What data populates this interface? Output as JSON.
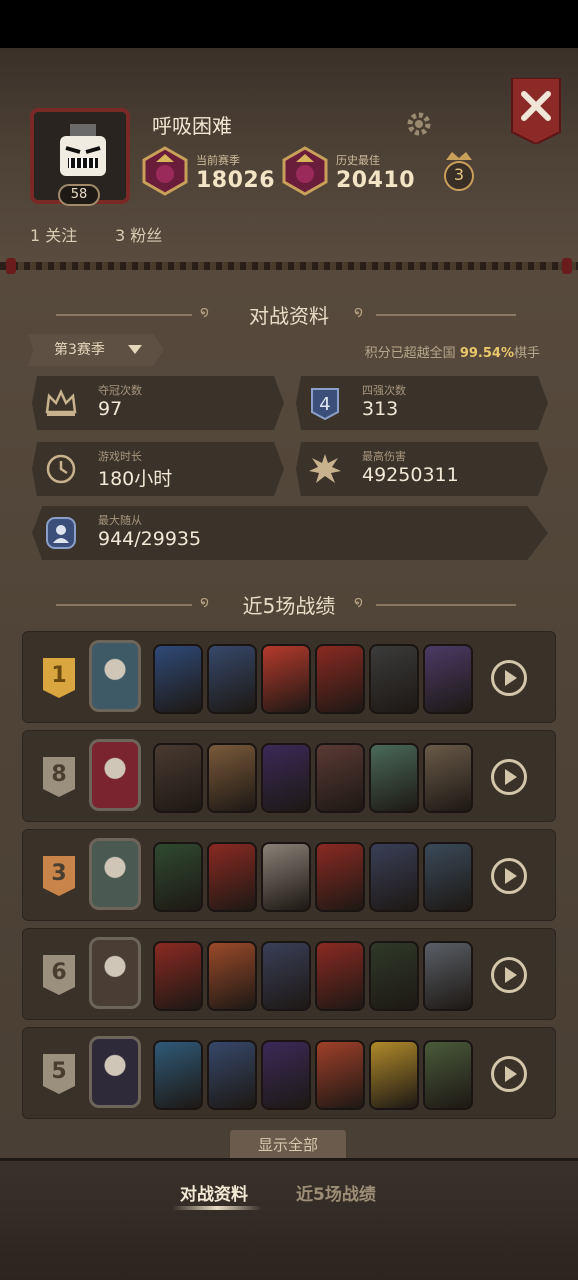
{
  "profile": {
    "name": "呼吸困难",
    "level": "58",
    "current_season_label": "当前赛季",
    "current_season_value": "18026",
    "best_label": "历史最佳",
    "best_value": "20410",
    "crown_count": "3",
    "following": "1 关注",
    "followers": "3 粉丝"
  },
  "battle_section": {
    "title": "对战资料",
    "season_select": "第3赛季",
    "beat_prefix": "积分已超越全国",
    "beat_percent": "99.54%",
    "beat_suffix": "棋手"
  },
  "stats": [
    {
      "label": "夺冠次数",
      "value": "97",
      "icon": "crown-icon"
    },
    {
      "label": "四强次数",
      "value": "313",
      "icon": "four-badge-icon"
    },
    {
      "label": "游戏时长",
      "value": "180小时",
      "icon": "clock-icon"
    },
    {
      "label": "最高伤害",
      "value": "49250311",
      "icon": "explosion-icon"
    },
    {
      "label": "最大随从",
      "value": "944/29935",
      "icon": "portrait-icon"
    }
  ],
  "recent_section": {
    "title": "近5场战绩",
    "matches": [
      {
        "place": "1",
        "badge_color": "#d9a640",
        "hero_color": "#3d5a66",
        "units": [
          "#2f4a78",
          "#36486a",
          "#b53a2c",
          "#8a2a22",
          "#3b3b3b",
          "#4b3b66"
        ]
      },
      {
        "place": "8",
        "badge_color": "#9b8f7e",
        "hero_color": "#7a2430",
        "units": [
          "#4a3a30",
          "#7a5a3a",
          "#3a2a58",
          "#5a3a34",
          "#4a6a5a",
          "#6a5a48"
        ]
      },
      {
        "place": "3",
        "badge_color": "#c9844a",
        "hero_color": "#4a5a52",
        "units": [
          "#2f4a30",
          "#8a2a22",
          "#8a8076",
          "#8a2a22",
          "#3a3f58",
          "#3a4a5a"
        ]
      },
      {
        "place": "6",
        "badge_color": "#9b8f7e",
        "hero_color": "#4a3e34",
        "units": [
          "#8a2a22",
          "#9a4a2a",
          "#3a3f58",
          "#8a2a22",
          "#2f3a28",
          "#5a5f66"
        ]
      },
      {
        "place": "5",
        "badge_color": "#9b8f7e",
        "hero_color": "#2e2a3a",
        "units": [
          "#2f5a78",
          "#36486a",
          "#3a2a58",
          "#a0402a",
          "#b08a2a",
          "#4a5a3a"
        ]
      }
    ]
  },
  "show_all": "显示全部",
  "tabs": [
    "对战资料",
    "近5场战绩"
  ],
  "colors": {
    "accent_gold": "#e9c76b",
    "close_red": "#8c2a28"
  }
}
